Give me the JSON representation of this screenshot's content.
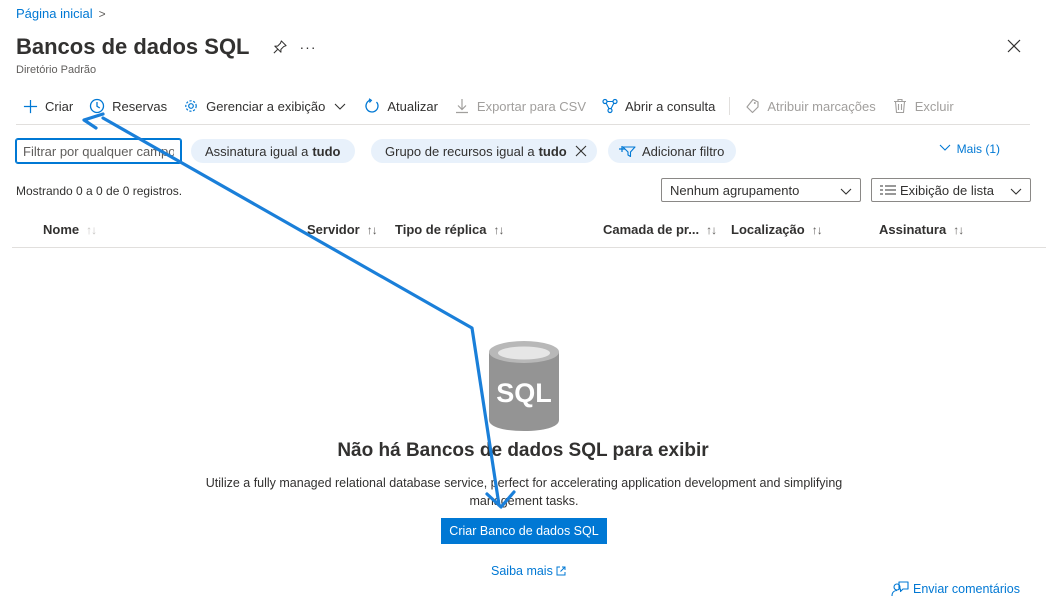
{
  "breadcrumb": {
    "home": "Página inicial",
    "chevron": ">"
  },
  "header": {
    "title": "Bancos de dados SQL",
    "subtitle": "Diretório Padrão",
    "more": "···"
  },
  "toolbar": {
    "create": "Criar",
    "reservations": "Reservas",
    "manage_view": "Gerenciar a exibição",
    "refresh": "Atualizar",
    "export_csv": "Exportar para CSV",
    "open_query": "Abrir a consulta",
    "assign_tags": "Atribuir marcações",
    "delete": "Excluir"
  },
  "filters": {
    "search_placeholder": "Filtrar por qualquer campo...",
    "subscription_label": "Assinatura igual a",
    "subscription_value": "tudo",
    "resource_group_label": "Grupo de recursos igual a",
    "resource_group_value": "tudo",
    "add_filter": "Adicionar filtro",
    "more": "Mais (1)"
  },
  "list": {
    "records": "Mostrando 0 a 0 de 0 registros.",
    "grouping": "Nenhum agrupamento",
    "view": "Exibição de lista",
    "columns": [
      "Nome",
      "Servidor",
      "Tipo de réplica",
      "Camada de pr...",
      "Localização",
      "Assinatura"
    ],
    "sort_symbol": "↑↓"
  },
  "empty_state": {
    "icon_text": "SQL",
    "title": "Não há Bancos de dados SQL para exibir",
    "description": "Utilize a fully managed relational database service, perfect for accelerating application development and simplifying management tasks.",
    "create_button": "Criar Banco de dados SQL",
    "learn_more": "Saiba mais"
  },
  "feedback": "Enviar comentários",
  "colors": {
    "accent": "#0078d4",
    "pill_bg": "#e8f1fb",
    "annotation": "#1a7fd9",
    "icon_gray": "#949494"
  }
}
